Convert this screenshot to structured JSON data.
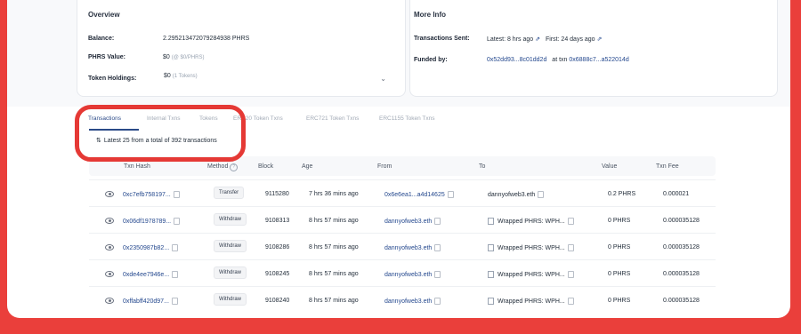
{
  "overview": {
    "title": "Overview",
    "balance_label": "Balance:",
    "balance_value": "2.295213472079284938 PHRS",
    "value_label": "PHRS Value:",
    "value_amount": "$0",
    "value_rate": "(@ $0/PHRS)",
    "holdings_label": "Token Holdings:",
    "holdings_value": "$0",
    "holdings_count": "(1 Tokens)"
  },
  "more_info": {
    "title": "More Info",
    "sent_label": "Transactions Sent:",
    "latest": "Latest: 8 hrs ago",
    "first": "First: 24 days ago",
    "funded_label": "Funded by:",
    "funded_addr": "0x52dd93...8c01dd2d",
    "at_txn": "at txn",
    "funded_txn": "0x6888c7...a522014d"
  },
  "tabs": [
    "Transactions",
    "Internal Txns",
    "Tokens",
    "ERC20 Token Txns",
    "ERC721 Token Txns",
    "ERC1155 Token Txns"
  ],
  "summary": "Latest 25 from a total of 392 transactions",
  "table": {
    "headers": {
      "hash": "Txn Hash",
      "method": "Method",
      "block": "Block",
      "age": "Age",
      "from": "From",
      "to": "To",
      "value": "Value",
      "fee": "Txn Fee"
    },
    "rows": [
      {
        "hash": "0xc7efb758197...",
        "method": "Transfer",
        "block": "9115280",
        "age": "7 hrs 36 mins ago",
        "from": "0x6e6ea1...a4d14625",
        "to": "dannyofweb3.eth",
        "value": "0.2 PHRS",
        "fee": "0.000021"
      },
      {
        "hash": "0x06df1978789...",
        "method": "Withdraw",
        "block": "9108313",
        "age": "8 hrs 57 mins ago",
        "from": "dannyofweb3.eth",
        "to": "Wrapped PHRS: WPH...",
        "value": "0 PHRS",
        "fee": "0.000035128"
      },
      {
        "hash": "0x2350987b82...",
        "method": "Withdraw",
        "block": "9108286",
        "age": "8 hrs 57 mins ago",
        "from": "dannyofweb3.eth",
        "to": "Wrapped PHRS: WPH...",
        "value": "0 PHRS",
        "fee": "0.000035128"
      },
      {
        "hash": "0xde4ee7946e...",
        "method": "Withdraw",
        "block": "9108245",
        "age": "8 hrs 57 mins ago",
        "from": "dannyofweb3.eth",
        "to": "Wrapped PHRS: WPH...",
        "value": "0 PHRS",
        "fee": "0.000035128"
      },
      {
        "hash": "0xffabff420d97...",
        "method": "Withdraw",
        "block": "9108240",
        "age": "8 hrs 57 mins ago",
        "from": "dannyofweb3.eth",
        "to": "Wrapped PHRS: WPH...",
        "value": "0 PHRS",
        "fee": "0.000035128"
      }
    ]
  },
  "colors": {
    "accent": "#2b4a88",
    "highlight": "#e53935",
    "background": "#ea3f3b"
  }
}
